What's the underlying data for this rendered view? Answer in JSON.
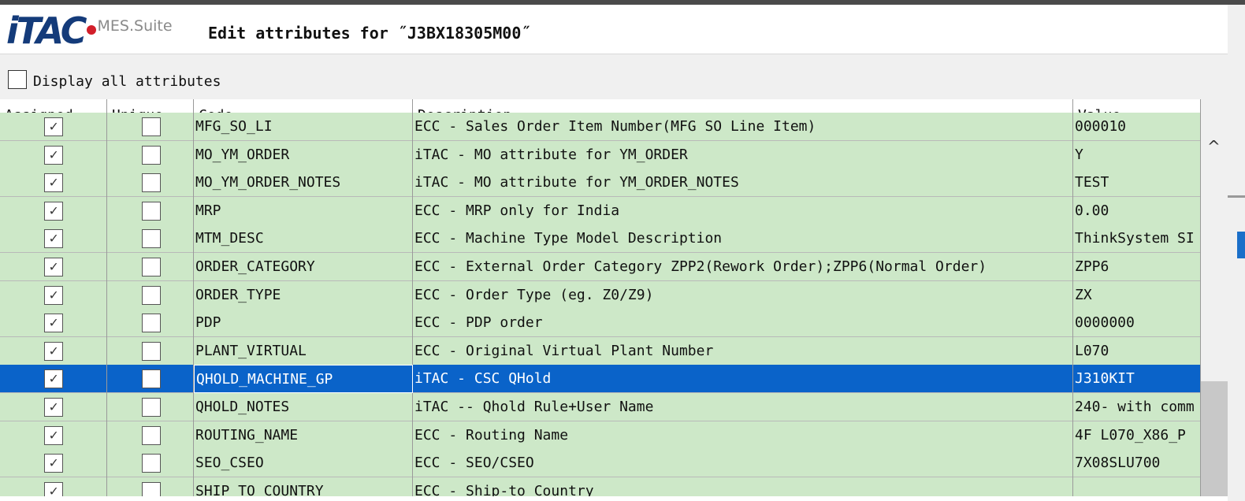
{
  "header": {
    "logo_text": "iTAC",
    "logo_suite": "MES.Suite",
    "title": "Edit attributes for ˝J3BX18305M00˝"
  },
  "toolbar": {
    "display_all_label": "Display all attributes",
    "display_all_checked": false
  },
  "columns": [
    {
      "key": "assigned",
      "label": "Assigned"
    },
    {
      "key": "unique",
      "label": "Unique"
    },
    {
      "key": "code",
      "label": "Code"
    },
    {
      "key": "description",
      "label": "Description"
    },
    {
      "key": "value",
      "label": "Value"
    }
  ],
  "rows": [
    {
      "assigned": true,
      "unique": false,
      "code": "MFG_SO_LI",
      "description": "ECC - Sales Order Item Number(MFG SO Line Item)",
      "value": "000010",
      "selected": false
    },
    {
      "assigned": true,
      "unique": false,
      "code": "MO_YM_ORDER",
      "description": "iTAC - MO attribute for YM_ORDER",
      "value": "Y",
      "selected": false
    },
    {
      "assigned": true,
      "unique": false,
      "code": "MO_YM_ORDER_NOTES",
      "description": "iTAC - MO attribute for YM_ORDER_NOTES",
      "value": "TEST",
      "selected": false
    },
    {
      "assigned": true,
      "unique": false,
      "code": "MRP",
      "description": "ECC - MRP only for India",
      "value": "0.00",
      "selected": false
    },
    {
      "assigned": true,
      "unique": false,
      "code": "MTM_DESC",
      "description": "ECC - Machine Type Model Description",
      "value": "ThinkSystem SI",
      "selected": false
    },
    {
      "assigned": true,
      "unique": false,
      "code": "ORDER_CATEGORY",
      "description": "ECC - External Order Category ZPP2(Rework Order);ZPP6(Normal Order)",
      "value": "ZPP6",
      "selected": false
    },
    {
      "assigned": true,
      "unique": false,
      "code": "ORDER_TYPE",
      "description": "ECC - Order Type (eg. Z0/Z9)",
      "value": "ZX",
      "selected": false
    },
    {
      "assigned": true,
      "unique": false,
      "code": "PDP",
      "description": "ECC - PDP order",
      "value": "0000000",
      "selected": false
    },
    {
      "assigned": true,
      "unique": false,
      "code": "PLANT_VIRTUAL",
      "description": "ECC - Original Virtual Plant Number",
      "value": "L070",
      "selected": false
    },
    {
      "assigned": true,
      "unique": false,
      "code": "QHOLD_MACHINE_GP",
      "description": "iTAC - CSC QHold",
      "value": "J310KIT",
      "selected": true
    },
    {
      "assigned": true,
      "unique": false,
      "code": "QHOLD_NOTES",
      "description": "iTAC -- Qhold Rule+User Name",
      "value": "240- with comm",
      "selected": false
    },
    {
      "assigned": true,
      "unique": false,
      "code": "ROUTING_NAME",
      "description": "ECC - Routing Name",
      "value": "4F L070_X86_P",
      "selected": false
    },
    {
      "assigned": true,
      "unique": false,
      "code": "SEO_CSEO",
      "description": "ECC - SEO/CSEO",
      "value": "7X08SLU700",
      "selected": false
    },
    {
      "assigned": true,
      "unique": false,
      "code": "SHIP_TO_COUNTRY",
      "description": "ECC - Ship-to Country",
      "value": "",
      "selected": false
    }
  ],
  "scrollbar": {
    "up_glyph": "^"
  },
  "colors": {
    "row_bg": "#cde8c8",
    "selected_bg": "#0a63c9",
    "logo_blue": "#143b7a",
    "logo_red": "#d21f2a"
  }
}
